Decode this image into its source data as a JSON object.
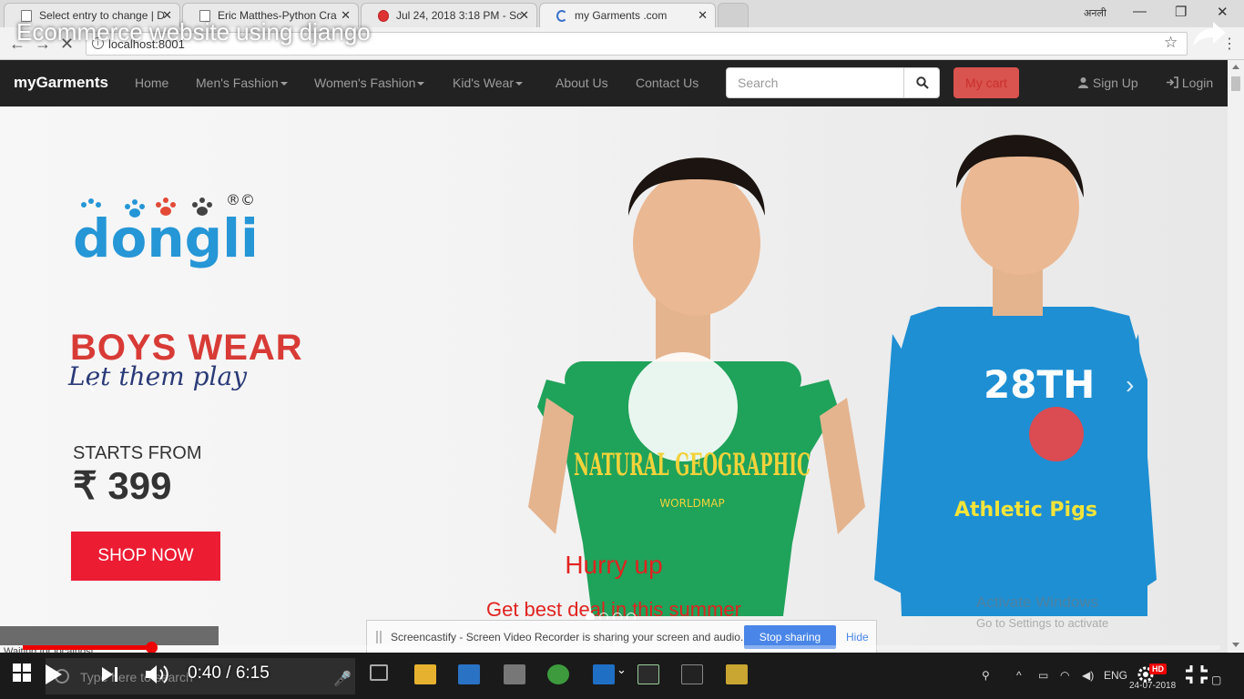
{
  "video": {
    "title": "Ecommerce website using django",
    "time_current": "0:40",
    "time_total": "6:15",
    "progress_fraction": 0.107,
    "quality_badge": "HD"
  },
  "browser": {
    "tabs": [
      {
        "title": "Select entry to change | D",
        "active": false
      },
      {
        "title": "Eric Matthes-Python Cra",
        "active": false
      },
      {
        "title": "Jul 24, 2018 3:18 PM - Sc",
        "active": false
      },
      {
        "title": "my Garments .com",
        "active": true
      }
    ],
    "url": "localhost:8001",
    "user_label": "अनली",
    "status_text": "Waiting for localhost..."
  },
  "site": {
    "brand": "myGarments",
    "nav": [
      {
        "label": "Home",
        "dropdown": false
      },
      {
        "label": "Men's Fashion",
        "dropdown": true
      },
      {
        "label": "Women's Fashion",
        "dropdown": true
      },
      {
        "label": "Kid's Wear",
        "dropdown": true
      },
      {
        "label": "About Us",
        "dropdown": false
      },
      {
        "label": "Contact Us",
        "dropdown": false
      }
    ],
    "search_placeholder": "Search",
    "cart_label": "My cart",
    "signup_label": "Sign Up",
    "login_label": "Login",
    "colors": {
      "navbar": "#222222",
      "cart": "#d9534f",
      "accent_red": "#e0231f"
    }
  },
  "banner": {
    "logo_text": "dongli",
    "headline": "BOYS WEAR",
    "tagline": "Let them play",
    "starts_from": "STARTS FROM",
    "price": "₹ 399",
    "shop_button": "SHOP NOW",
    "shirt_left_text": "NATURAL GEOGRAPHIC",
    "shirt_left_sub": "WORLDMAP",
    "shirt_right_number": "28TH",
    "shirt_right_text": "Athletic Pigs",
    "caption_title": "Hurry up",
    "caption_text": "Get best deal in this summer",
    "indicators": 4,
    "active_indicator": 0
  },
  "watermark": {
    "line1": "Activate Windows",
    "line2": "Go to Settings to activate"
  },
  "screencastify": {
    "message": "Screencastify - Screen Video Recorder is sharing your screen and audio.",
    "stop_label": "Stop sharing",
    "hide_label": "Hide"
  },
  "taskbar": {
    "search_placeholder": "Type here to search",
    "lang": "ENG",
    "date": "24-07-2018"
  }
}
